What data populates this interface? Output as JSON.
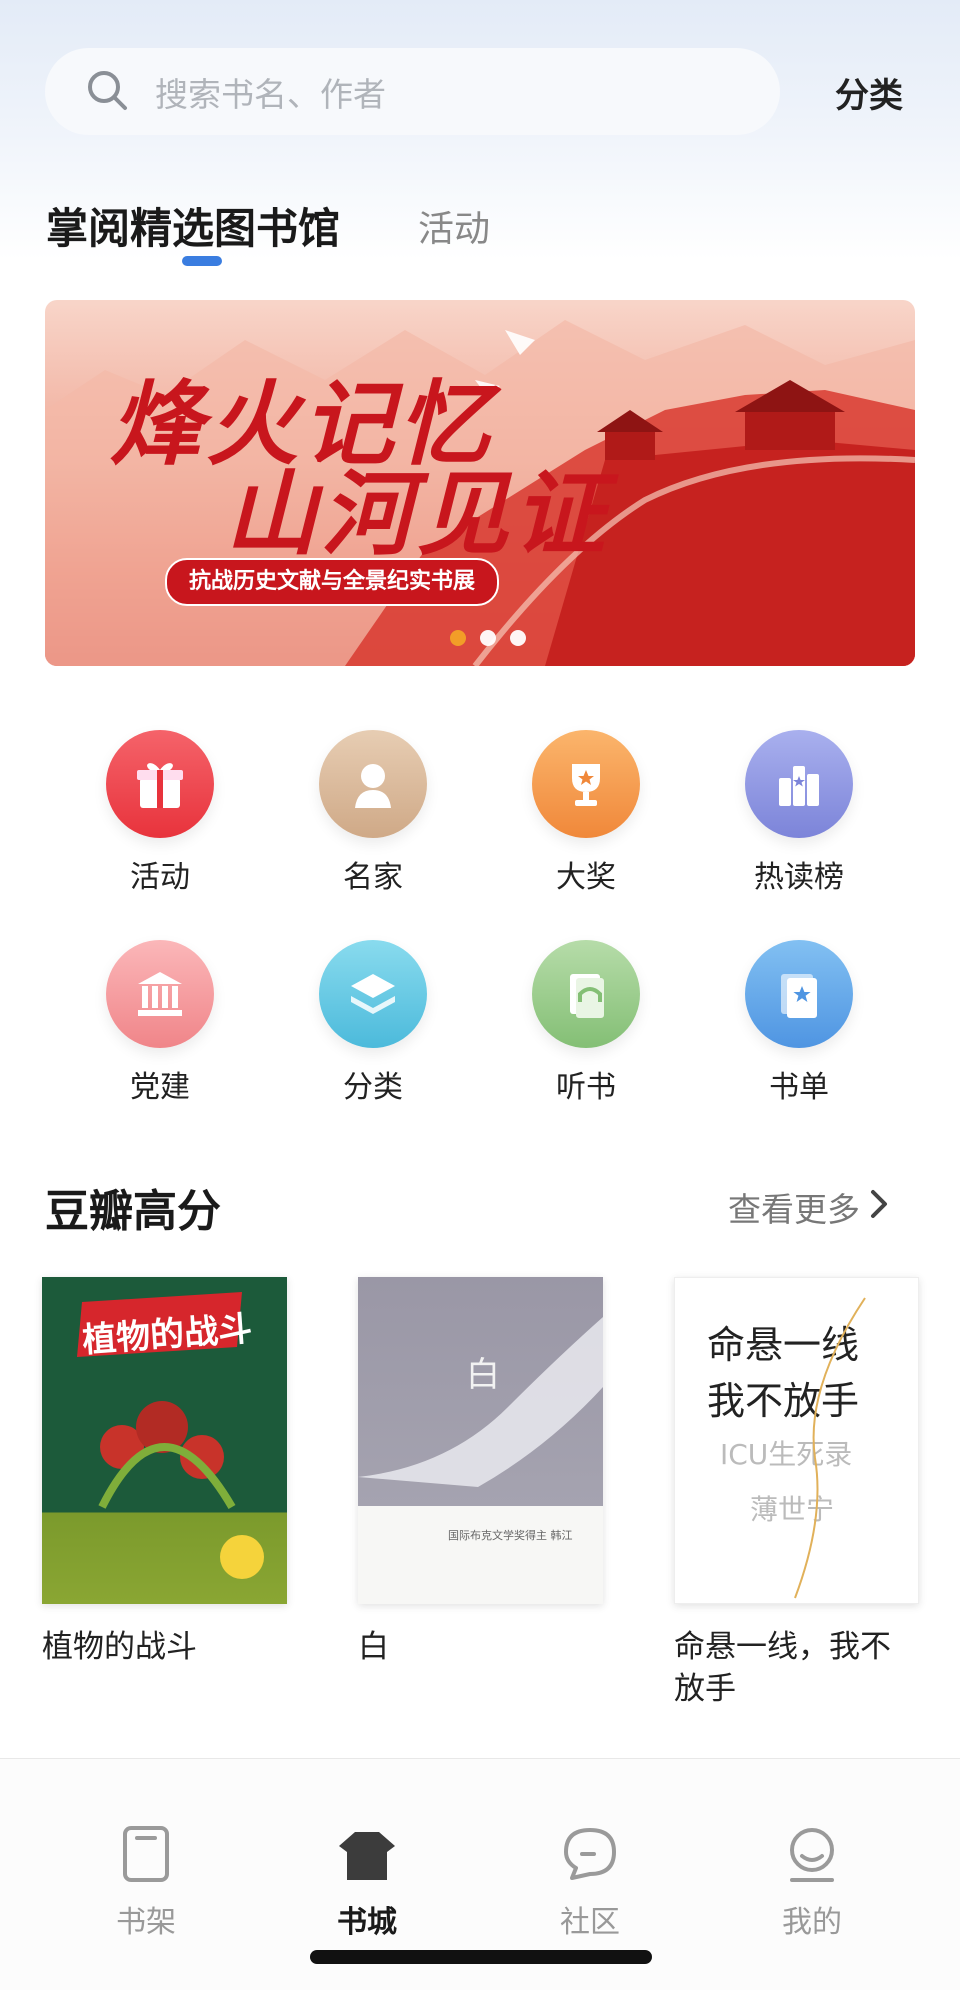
{
  "search": {
    "placeholder": "搜索书名、作者",
    "category_link": "分类"
  },
  "tabs": {
    "main": "掌阅精选图书馆",
    "secondary": "活动"
  },
  "banner": {
    "title_line1": "烽火记忆",
    "title_line2": "山河见证",
    "subtitle": "抗战历史文献与全景纪实书展",
    "slide_count": 3,
    "active_slide": 1
  },
  "shortcuts": [
    {
      "label": "活动",
      "icon": "gift-icon"
    },
    {
      "label": "名家",
      "icon": "person-icon"
    },
    {
      "label": "大奖",
      "icon": "trophy-icon"
    },
    {
      "label": "热读榜",
      "icon": "ranking-icon"
    },
    {
      "label": "党建",
      "icon": "building-icon"
    },
    {
      "label": "分类",
      "icon": "layers-icon"
    },
    {
      "label": "听书",
      "icon": "headphones-book-icon"
    },
    {
      "label": "书单",
      "icon": "booklist-icon"
    }
  ],
  "section": {
    "title": "豆瓣高分",
    "more": "查看更多"
  },
  "books": [
    {
      "title": "植物的战斗",
      "cover_text": "植物的战斗"
    },
    {
      "title": "白",
      "cover_text": "白",
      "cover_caption": "国际布克文学奖得主 韩江"
    },
    {
      "title": "命悬一线，我不放手",
      "cover_line1": "命悬一线",
      "cover_line2": "我不放手",
      "cover_line3": "ICU生死录",
      "cover_author": "薄世宁"
    }
  ],
  "bottom_nav": [
    {
      "label": "书架",
      "icon": "bookshelf-icon",
      "active": false
    },
    {
      "label": "书城",
      "icon": "bookstore-icon",
      "active": true
    },
    {
      "label": "社区",
      "icon": "chat-bubble-icon",
      "active": false
    },
    {
      "label": "我的",
      "icon": "profile-icon",
      "active": false
    }
  ]
}
